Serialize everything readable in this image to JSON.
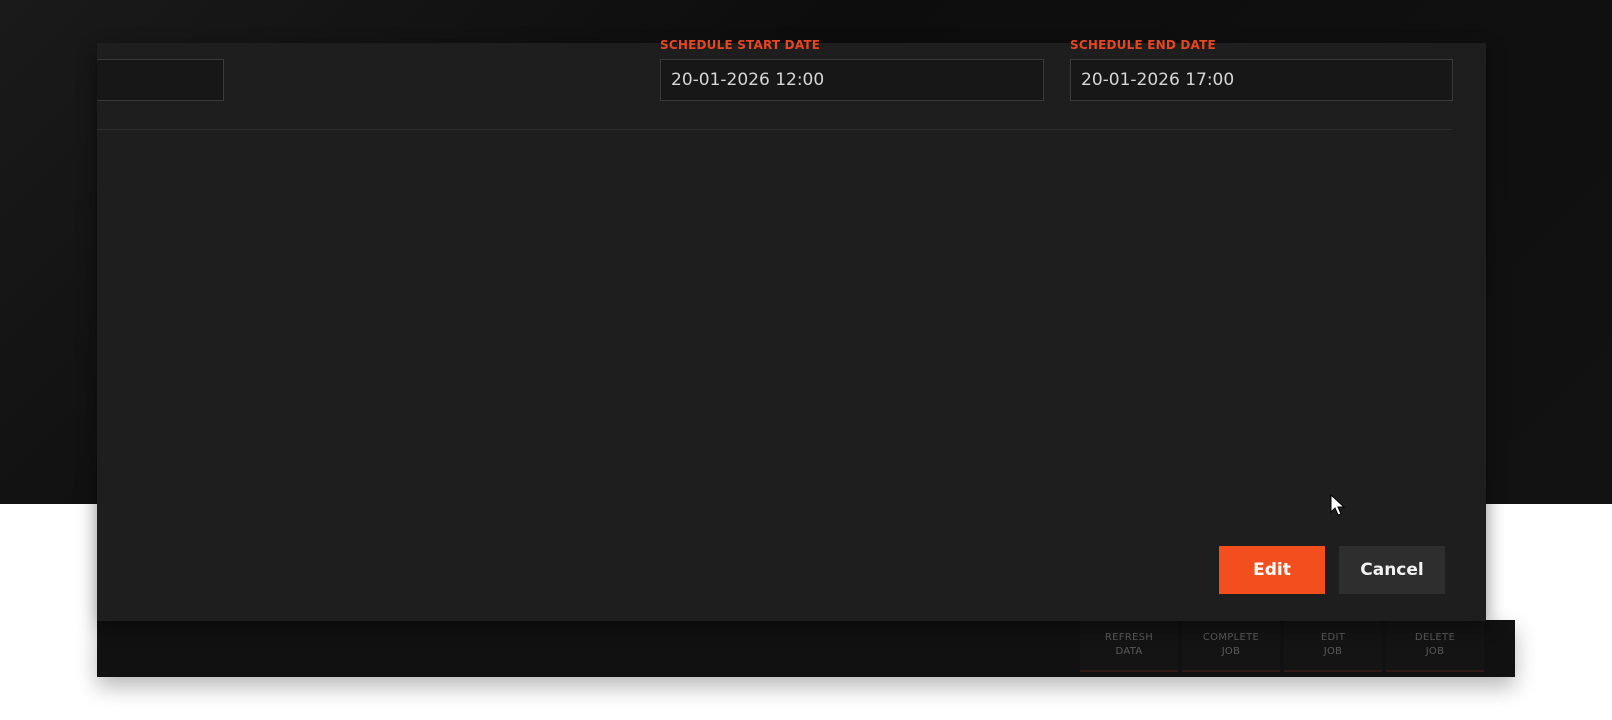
{
  "modal": {
    "fields": {
      "left_field": {
        "value": ""
      },
      "schedule_start": {
        "label": "SCHEDULE START DATE",
        "value": "20-01-2026 12:00"
      },
      "schedule_end": {
        "label": "SCHEDULE END DATE",
        "value": "20-01-2026 17:00"
      }
    },
    "buttons": {
      "edit_label": "Edit",
      "cancel_label": "Cancel"
    }
  },
  "toolbar": {
    "items": [
      {
        "label": "REFRESH\nDATA"
      },
      {
        "label": "COMPLETE\nJOB"
      },
      {
        "label": "EDIT\nJOB"
      },
      {
        "label": "DELETE\nJOB"
      }
    ]
  },
  "colors": {
    "accent": "#f24e1e",
    "modal_bg": "#1e1e1e",
    "input_bg": "#171717",
    "label": "#e8461e"
  }
}
